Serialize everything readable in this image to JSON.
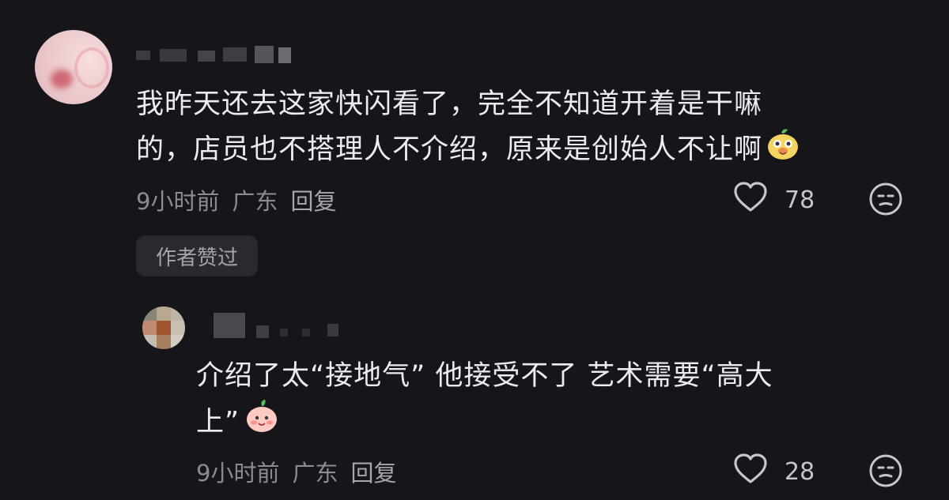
{
  "comment": {
    "text_line1": "我昨天还去这家快闪看了，完全不知道开着是干嘛",
    "text_line2": "的，店员也不搭理人不介绍，原来是创始人不让啊",
    "time": "9小时前",
    "location": "广东",
    "reply_label": "回复",
    "likes": "78",
    "author_badge": "作者赞过"
  },
  "reply": {
    "text_line1": "介绍了太“接地气” 他接受不了 艺术需要“高大",
    "text_line2": "上”",
    "time": "9小时前",
    "location": "广东",
    "reply_label": "回复",
    "likes": "28"
  },
  "icons": {
    "heart": "heart-outline-icon",
    "dislike": "meh-face-icon"
  },
  "colors": {
    "background": "#161519",
    "text": "#ecebef",
    "meta": "#8d8b92"
  }
}
